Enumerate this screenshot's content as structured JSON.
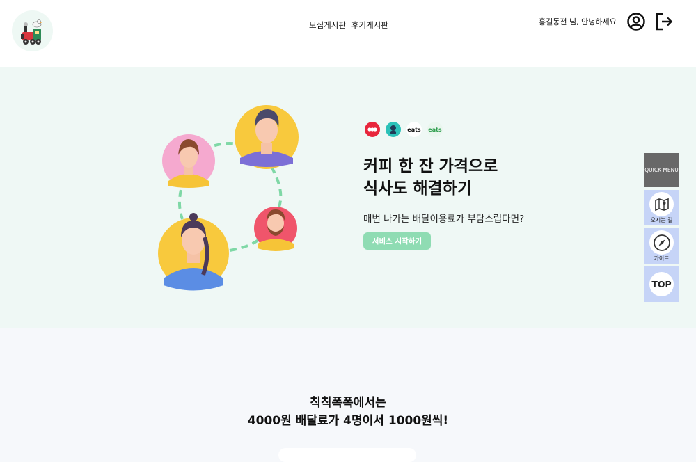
{
  "header": {
    "logo_icon": "train-logo-icon",
    "nav": [
      "모집게시판",
      "후기게시판"
    ],
    "greeting": "홍길동전 님, 안녕하세요",
    "user_icon": "user-circle-icon",
    "logout_icon": "logout-icon"
  },
  "hero": {
    "brands": [
      {
        "icon": "yogiyo-icon",
        "color": "#e8263c"
      },
      {
        "icon": "baemin-rider-icon",
        "color": "#2bc1b8"
      },
      {
        "icon": "coupang-eats-icon-1",
        "color": "#111111",
        "text": "eats"
      },
      {
        "icon": "coupang-eats-icon-2",
        "color": "#2f9e4e",
        "text": "eats"
      }
    ],
    "title_line1": "커피 한 잔 가격으로",
    "title_line2": "식사도 해결하기",
    "subtitle": "매번 나가는 배달이용료가 부담스럽다면?",
    "cta": "서비스 시작하기",
    "accent": "#8fdcb3"
  },
  "quick_menu": {
    "header": "QUICK MENU",
    "items": [
      {
        "label": "오시는 길",
        "icon": "map-icon"
      },
      {
        "label": "가이드",
        "icon": "compass-icon"
      },
      {
        "label": "TOP",
        "icon": "top-icon"
      }
    ]
  },
  "section": {
    "line1": "칙칙폭폭에서는",
    "line2": "4000원 배달료가 4명이서 1000원씩!"
  }
}
